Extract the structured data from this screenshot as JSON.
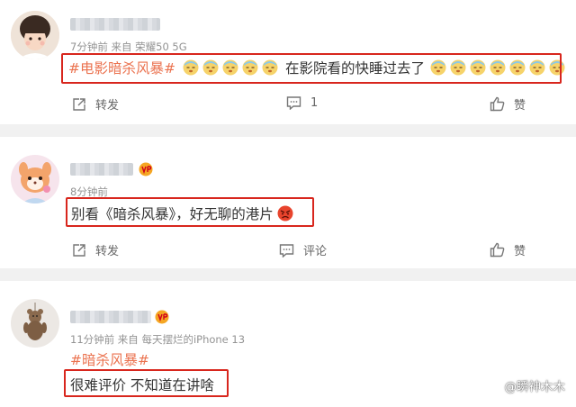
{
  "post1": {
    "meta": "7分钟前  来自 荣耀50 5G",
    "topic": "#电影暗杀风暴#",
    "text": "在影院看的快睡过去了",
    "actions": {
      "repost": "转发",
      "comment_count": "1",
      "like": "赞"
    }
  },
  "post2": {
    "meta": "8分钟前",
    "text": "别看《暗杀风暴》，好无聊的港片",
    "actions": {
      "repost": "转发",
      "comment": "评论",
      "like": "赞"
    }
  },
  "post3": {
    "meta": "11分钟前  来自 每天摆烂的iPhone 13",
    "topic": "#暗杀风暴#",
    "text": "很难评价 不知道在讲啥"
  },
  "watermark": "@瞬神木木",
  "icons": {
    "sleepy_emoji": "sleepy-face-emoji",
    "angry_emoji": "angry-face-emoji",
    "repost": "share-arrow-icon",
    "comment": "comment-bubble-icon",
    "like": "thumbs-up-icon",
    "vip": "vip-badge-icon",
    "watermark_logo": "platform-logo-icon"
  },
  "colors": {
    "topic": "#eb7350",
    "highlight_box": "#d8261d"
  }
}
